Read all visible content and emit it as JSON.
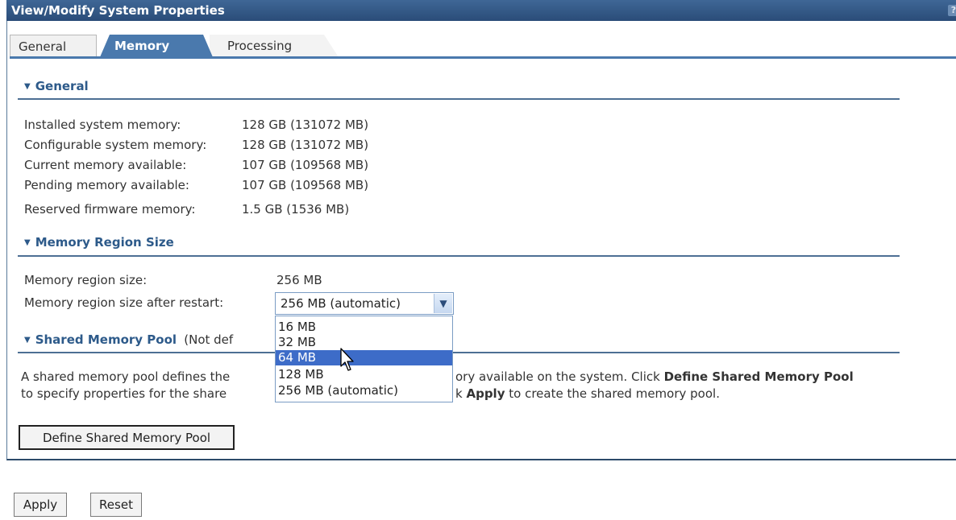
{
  "window": {
    "title": "View/Modify System Properties",
    "help_glyph": "?"
  },
  "tabs": [
    {
      "label": "General"
    },
    {
      "label": "Memory",
      "active": true
    },
    {
      "label": "Processing"
    }
  ],
  "general": {
    "heading": "General",
    "rows": [
      {
        "label": "Installed system memory:",
        "value": "128 GB (131072 MB)"
      },
      {
        "label": "Configurable system memory:",
        "value": "128 GB (131072 MB)"
      },
      {
        "label": "Current memory available:",
        "value": "107 GB (109568 MB)"
      },
      {
        "label": "Pending memory available:",
        "value": "107 GB (109568 MB)"
      },
      {
        "label": "Reserved firmware memory:",
        "value": "1.5 GB (1536 MB)"
      }
    ]
  },
  "region": {
    "heading": "Memory Region Size",
    "size_label": "Memory region size:",
    "size_value": "256 MB",
    "restart_label": "Memory region size after restart:",
    "restart_selected": "256 MB (automatic)",
    "options": [
      "16 MB",
      "32 MB",
      "64 MB",
      "128 MB",
      "256 MB (automatic)"
    ],
    "highlighted_option": "64 MB"
  },
  "pool": {
    "heading": "Shared Memory Pool",
    "heading_suffix": "(Not def",
    "line1_a": "A shared memory pool defines the",
    "line1_b": "ory available on the system. Click ",
    "line1_bold": "Define Shared Memory Pool",
    "line2_a": "to specify properties for the share",
    "line2_b": "k ",
    "line2_bold": "Apply",
    "line2_c": " to create the shared memory pool.",
    "define_button": "Define Shared Memory Pool"
  },
  "footer": {
    "apply": "Apply",
    "reset": "Reset"
  },
  "colors": {
    "title_bar": "#2f5582",
    "active_tab": "#4a79ad",
    "section_heading": "#2d5a8a",
    "selected_option": "#3d6cc8"
  },
  "icons": {
    "section_toggle": "triangle-down-icon",
    "dropdown": "chevron-down-icon",
    "pointer": "mouse-pointer-icon"
  }
}
